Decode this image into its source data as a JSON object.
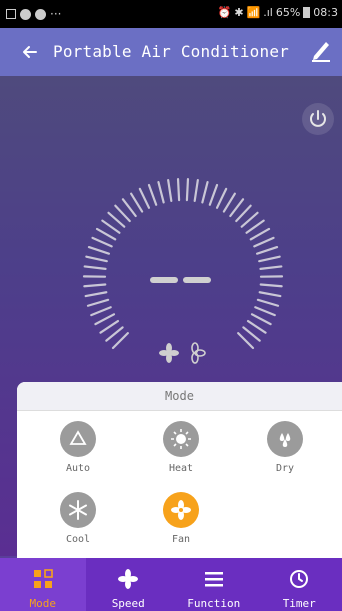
{
  "status_bar": {
    "signal": ".ıl",
    "battery": "65%",
    "time": "08:3"
  },
  "header": {
    "title": "Portable Air Conditioner"
  },
  "mode_panel": {
    "title": "Mode",
    "options": [
      {
        "label": "Auto",
        "icon": "recycle-icon",
        "selected": false
      },
      {
        "label": "Heat",
        "icon": "sun-icon",
        "selected": false
      },
      {
        "label": "Dry",
        "icon": "water-drop-icon",
        "selected": false
      },
      {
        "label": "Cool",
        "icon": "snowflake-icon",
        "selected": false
      },
      {
        "label": "Fan",
        "icon": "fan-icon",
        "selected": true
      }
    ]
  },
  "bottom_nav": [
    {
      "label": "Mode",
      "icon": "mode-grid-icon",
      "active": true
    },
    {
      "label": "Speed",
      "icon": "fan-icon",
      "active": false
    },
    {
      "label": "Function",
      "icon": "menu-icon",
      "active": false
    },
    {
      "label": "Timer",
      "icon": "clock-icon",
      "active": false
    }
  ],
  "colors": {
    "accent": "#f7a21b",
    "header": "#6b6fc4",
    "nav": "#6a2ec0"
  }
}
